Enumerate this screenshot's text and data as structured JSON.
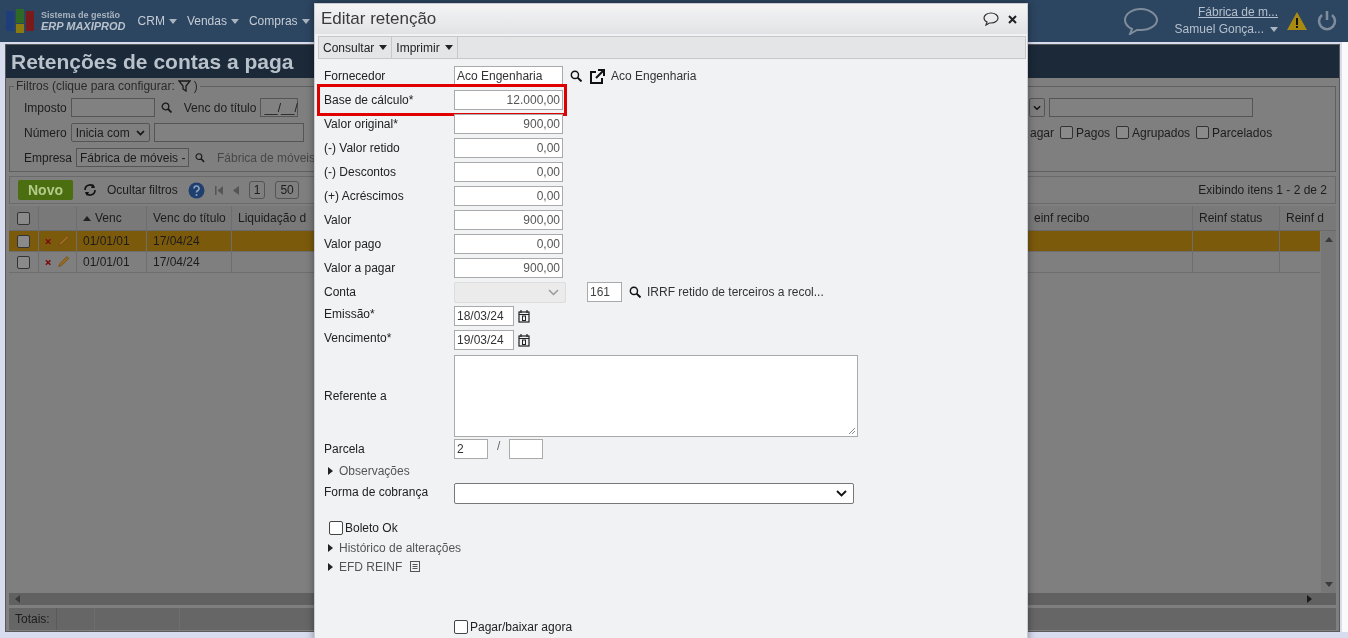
{
  "header": {
    "brand_small": "Sistema de gestão",
    "brand_name": "ERP MAXIPROD",
    "menus": [
      {
        "label": "CRM"
      },
      {
        "label": "Vendas"
      },
      {
        "label": "Compras"
      }
    ],
    "company": "Fábrica de m...",
    "user": "Samuel Gonça..."
  },
  "page": {
    "title": "Retenções de contas a paga",
    "filters": {
      "legend_before": "Filtros (clique para configurar:",
      "legend_after": ")",
      "imposto_label": "Imposto",
      "venc_label": "Venc do título",
      "venc_value": "__/__/",
      "numero_label": "Número",
      "numero_mode": "Inicia com",
      "empresa_label": "Empresa",
      "empresa_value": "Fábrica de móveis -",
      "empresa_name": "Fábrica de móveis",
      "status_partial": "agar",
      "status_options": [
        {
          "label": "Pagos",
          "checked": false
        },
        {
          "label": "Agrupados",
          "checked": false
        },
        {
          "label": "Parcelados",
          "checked": false
        }
      ]
    },
    "toolbar": {
      "new_button": "Novo",
      "hide_filters": "Ocultar filtros",
      "page": "1",
      "page_size": "50",
      "summary": "Exibindo itens 1 - 2 de 2"
    },
    "table": {
      "select_all_checked": false,
      "columns": [
        {
          "label": "Venc",
          "sorted": true
        },
        {
          "label": "Venc do título",
          "sorted": false
        },
        {
          "label": "Liquidação d",
          "sorted": false
        }
      ],
      "right_columns": [
        {
          "label": "einf recibo"
        },
        {
          "label": "Reinf status"
        },
        {
          "label": "Reinf d"
        }
      ],
      "rows": [
        {
          "checked": false,
          "selected": true,
          "venc": "01/01/01",
          "venc_titulo": "17/04/24"
        },
        {
          "checked": false,
          "selected": false,
          "venc": "01/01/01",
          "venc_titulo": "17/04/24"
        }
      ]
    },
    "totals_label": "Totais:"
  },
  "modal": {
    "title": "Editar retenção",
    "menus": [
      {
        "label": "Consultar"
      },
      {
        "label": "Imprimir"
      }
    ],
    "fields": [
      {
        "kind": "lookup",
        "label": "Fornecedor",
        "value": "Aco Engenharia",
        "name": "Aco Engenharia",
        "highlighted": false
      },
      {
        "kind": "number",
        "label": "Base de cálculo*",
        "value": "12.000,00",
        "highlighted": true
      },
      {
        "kind": "number",
        "label": "Valor original*",
        "value": "900,00",
        "highlighted": false
      },
      {
        "kind": "number",
        "label": "(-) Valor retido",
        "value": "0,00",
        "highlighted": false
      },
      {
        "kind": "number",
        "label": "(-) Descontos",
        "value": "0,00",
        "highlighted": false
      },
      {
        "kind": "number",
        "label": "(+) Acréscimos",
        "value": "0,00",
        "highlighted": false
      },
      {
        "kind": "number",
        "label": "Valor",
        "value": "900,00",
        "highlighted": false
      },
      {
        "kind": "number",
        "label": "Valor pago",
        "value": "0,00",
        "highlighted": false
      },
      {
        "kind": "number",
        "label": "Valor a pagar",
        "value": "900,00",
        "highlighted": false
      },
      {
        "kind": "account",
        "label": "Conta",
        "code": "161",
        "description": "IRRF retido de terceiros a recol...",
        "disabled": true
      },
      {
        "kind": "date",
        "label": "Emissão*",
        "value": "18/03/24"
      },
      {
        "kind": "date",
        "label": "Vencimento*",
        "value": "19/03/24"
      },
      {
        "kind": "textarea",
        "label": "Referente a"
      },
      {
        "kind": "installment",
        "label": "Parcela",
        "value": "2",
        "separator": "/"
      },
      {
        "kind": "section",
        "label": "Observações",
        "expanded": false,
        "info_icon": false
      },
      {
        "kind": "select",
        "label": "Forma de cobrança"
      },
      {
        "kind": "checkbox",
        "label": "Boleto Ok",
        "checked": false
      },
      {
        "kind": "section",
        "label": "Histórico de alterações",
        "expanded": false,
        "info_icon": false
      },
      {
        "kind": "section",
        "label": "EFD REINF",
        "expanded": false,
        "info_icon": true
      },
      {
        "kind": "action_checkbox",
        "label": "Pagar/baixar agora",
        "checked": false
      }
    ]
  }
}
